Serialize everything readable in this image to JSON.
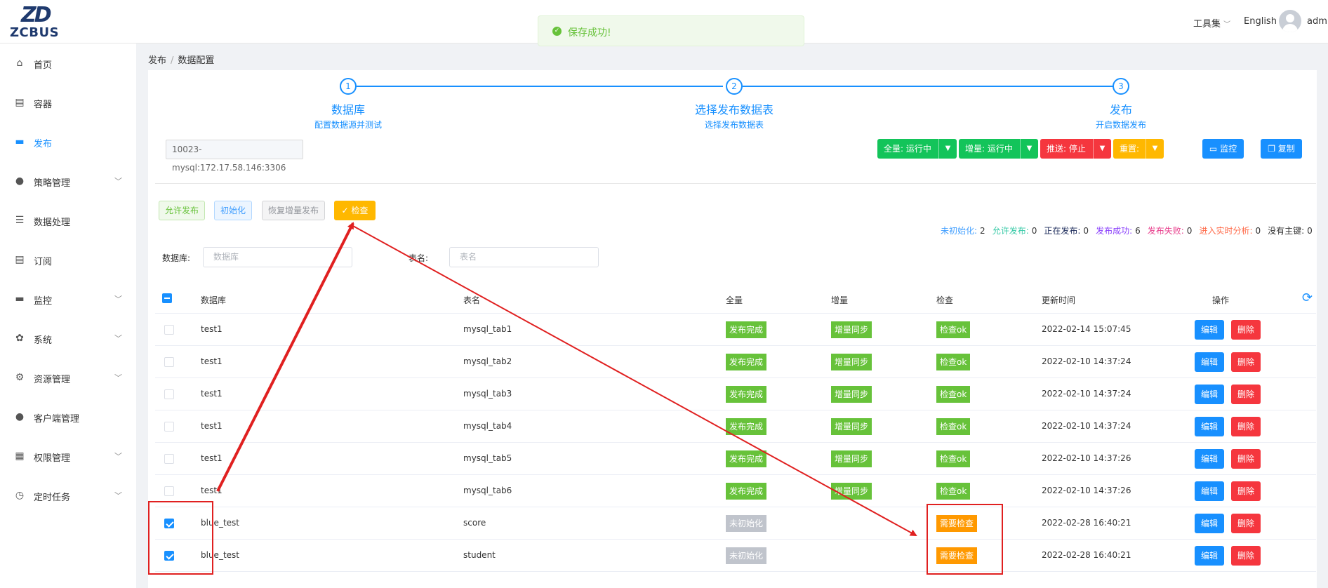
{
  "header": {
    "logo_text": "ZCBUS",
    "tools": "工具集",
    "language": "English",
    "user": "admin"
  },
  "toast": {
    "message": "保存成功!"
  },
  "sidebar": {
    "items": [
      {
        "label": "首页",
        "icon": "home-icon",
        "glyph": "⌂"
      },
      {
        "label": "容器",
        "icon": "clipboard-icon",
        "glyph": "▤"
      },
      {
        "label": "发布",
        "icon": "monitor-icon",
        "glyph": "▬"
      },
      {
        "label": "策略管理",
        "icon": "location-icon",
        "glyph": "●"
      },
      {
        "label": "数据处理",
        "icon": "sliders-icon",
        "glyph": "☰"
      },
      {
        "label": "订阅",
        "icon": "clipboard-check-icon",
        "glyph": "▤"
      },
      {
        "label": "监控",
        "icon": "monitor-icon",
        "glyph": "▬"
      },
      {
        "label": "系统",
        "icon": "gear-icon",
        "glyph": "✿"
      },
      {
        "label": "资源管理",
        "icon": "cog-icon",
        "glyph": "⚙"
      },
      {
        "label": "客户端管理",
        "icon": "user-icon",
        "glyph": "●"
      },
      {
        "label": "权限管理",
        "icon": "grid-icon",
        "glyph": "▦"
      },
      {
        "label": "定时任务",
        "icon": "clock-icon",
        "glyph": "◷"
      }
    ]
  },
  "breadcrumb": {
    "level1": "发布",
    "separator": "/",
    "level2": "数据配置"
  },
  "steps": [
    {
      "number": "1",
      "title": "数据库",
      "desc": "配置数据源并测试"
    },
    {
      "number": "2",
      "title": "选择发布数据表",
      "desc": "选择发布数据表"
    },
    {
      "number": "3",
      "title": "发布",
      "desc": "开启数据发布"
    }
  ],
  "db_selector": {
    "value": "10023-mysql:172.17.58.146:3306"
  },
  "controls": {
    "full": "全量: 运行中",
    "incremental": "增量: 运行中",
    "push": "推送: 停止",
    "reset": "重置:",
    "monitor": "监控",
    "copy": "复制"
  },
  "actions": {
    "allow_publish": "允许发布",
    "initialize": "初始化",
    "restore_incremental": "恢复增量发布",
    "check": "检查"
  },
  "stats": [
    {
      "label": "未初始化:",
      "value": "2",
      "color": "#409eff"
    },
    {
      "label": "允许发布:",
      "value": "0",
      "color": "#36c9a6"
    },
    {
      "label": "正在发布:",
      "value": "0",
      "color": "#1f2d5c"
    },
    {
      "label": "发布成功:",
      "value": "6",
      "color": "#8a3ffc"
    },
    {
      "label": "发布失败:",
      "value": "0",
      "color": "#e83e8c"
    },
    {
      "label": "进入实时分析:",
      "value": "0",
      "color": "#ff6b4a"
    },
    {
      "label": "没有主键:",
      "value": "0",
      "color": "#333333"
    }
  ],
  "filters": {
    "db_label": "数据库:",
    "db_placeholder": "数据库",
    "table_label": "表名:",
    "table_placeholder": "表名"
  },
  "table": {
    "headers": [
      "数据库",
      "表名",
      "全量",
      "增量",
      "检查",
      "更新时间",
      "操作"
    ],
    "rows": [
      {
        "checked": false,
        "db": "test1",
        "table": "mysql_tab1",
        "full": "发布完成",
        "full_color": "#67c23a",
        "inc": "增量同步",
        "check": "检查ok",
        "check_color": "#67c23a",
        "time": "2022-02-14 15:07:45"
      },
      {
        "checked": false,
        "db": "test1",
        "table": "mysql_tab2",
        "full": "发布完成",
        "full_color": "#67c23a",
        "inc": "增量同步",
        "check": "检查ok",
        "check_color": "#67c23a",
        "time": "2022-02-10 14:37:24"
      },
      {
        "checked": false,
        "db": "test1",
        "table": "mysql_tab3",
        "full": "发布完成",
        "full_color": "#67c23a",
        "inc": "增量同步",
        "check": "检查ok",
        "check_color": "#67c23a",
        "time": "2022-02-10 14:37:24"
      },
      {
        "checked": false,
        "db": "test1",
        "table": "mysql_tab4",
        "full": "发布完成",
        "full_color": "#67c23a",
        "inc": "增量同步",
        "check": "检查ok",
        "check_color": "#67c23a",
        "time": "2022-02-10 14:37:24"
      },
      {
        "checked": false,
        "db": "test1",
        "table": "mysql_tab5",
        "full": "发布完成",
        "full_color": "#67c23a",
        "inc": "增量同步",
        "check": "检查ok",
        "check_color": "#67c23a",
        "time": "2022-02-10 14:37:26"
      },
      {
        "checked": false,
        "db": "test1",
        "table": "mysql_tab6",
        "full": "发布完成",
        "full_color": "#67c23a",
        "inc": "增量同步",
        "check": "检查ok",
        "check_color": "#67c23a",
        "time": "2022-02-10 14:37:26"
      },
      {
        "checked": true,
        "db": "blue_test",
        "table": "score",
        "full": "未初始化",
        "full_color": "#c0c4cc",
        "inc": "",
        "check": "需要检查",
        "check_color": "#ff9900",
        "time": "2022-02-28 16:40:21"
      },
      {
        "checked": true,
        "db": "blue_test",
        "table": "student",
        "full": "未初始化",
        "full_color": "#c0c4cc",
        "inc": "",
        "check": "需要检查",
        "check_color": "#ff9900",
        "time": "2022-02-28 16:40:21"
      }
    ],
    "edit_label": "编辑",
    "delete_label": "删除"
  },
  "colors": {
    "primary": "#1890ff",
    "success": "#67c23a",
    "danger": "#f5363e",
    "warning": "#ffb800",
    "annotation": "#e02020"
  }
}
